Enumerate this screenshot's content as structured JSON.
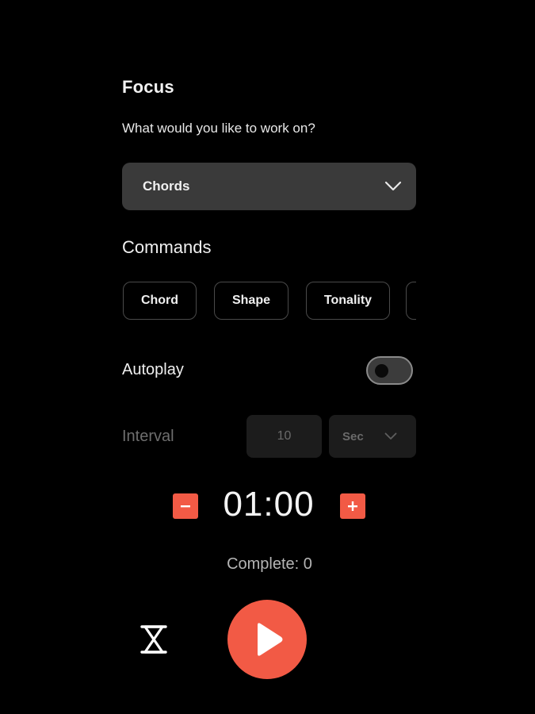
{
  "focus": {
    "title": "Focus",
    "question": "What would you like to work on?",
    "selected": "Chords"
  },
  "commands": {
    "heading": "Commands",
    "chips": [
      "Chord",
      "Shape",
      "Tonality"
    ]
  },
  "autoplay": {
    "label": "Autoplay",
    "enabled": false
  },
  "interval": {
    "label": "Interval",
    "value": "10",
    "unit": "Sec"
  },
  "timer": {
    "value": "01:00",
    "complete_text": "Complete: 0"
  },
  "icons": {
    "dropdown": "chevron-down-icon",
    "decrement": "minus-icon",
    "increment": "plus-icon",
    "timer_mode": "hourglass-icon",
    "play": "play-icon"
  },
  "colors": {
    "background": "#000000",
    "accent": "#f25a45",
    "dropdown_bg": "#3a3a3a",
    "chip_border": "#4a4a4a",
    "disabled_bg": "#1c1c1c",
    "disabled_text": "#6a6a6a"
  }
}
